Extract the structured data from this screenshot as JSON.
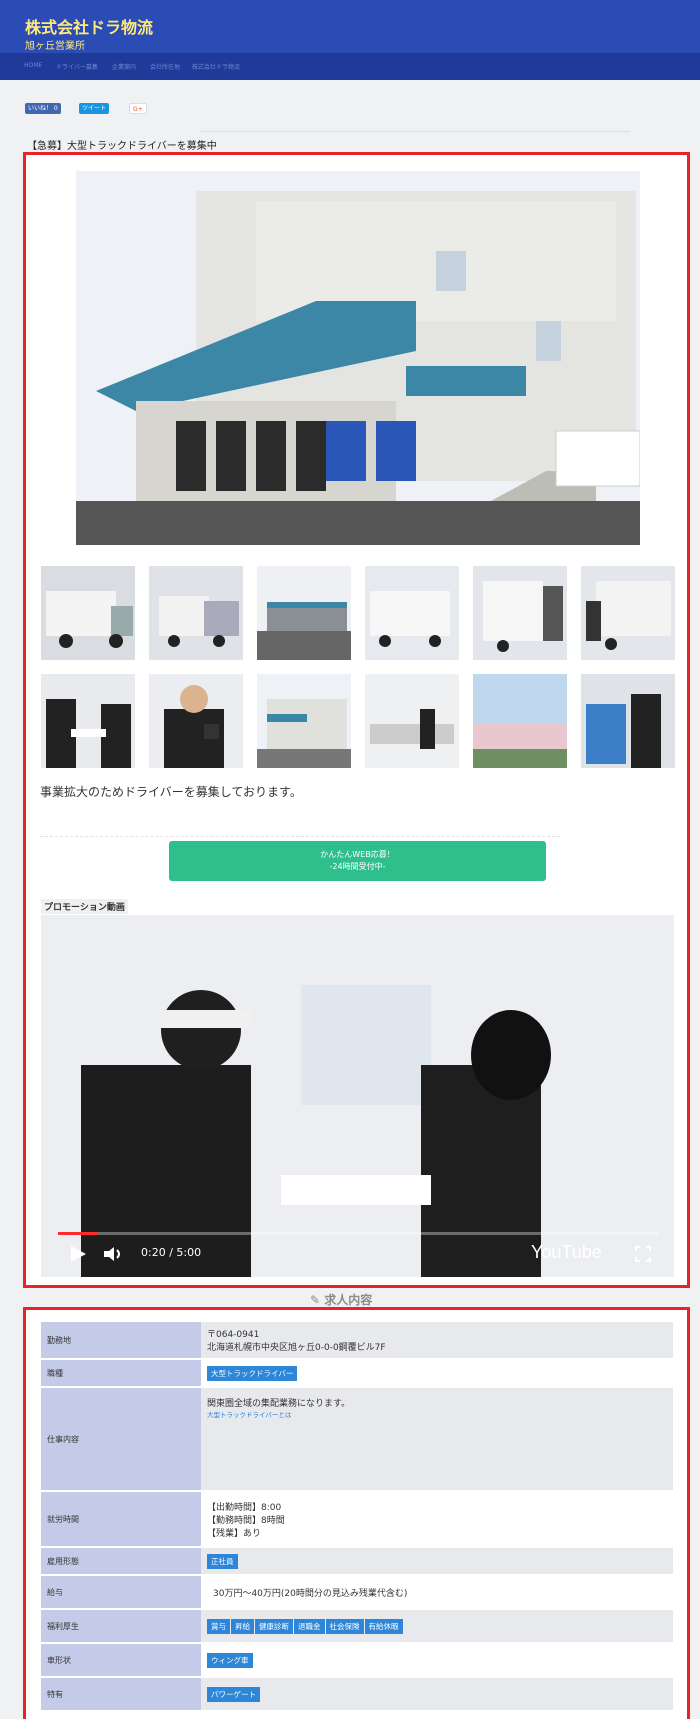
{
  "header": {
    "company": "株式会社ドラ物流",
    "branch": "旭ヶ丘営業所",
    "nav": [
      "HOME",
      "ドライバー募集",
      "企業案内",
      "会社所在地",
      "株式会社ドラ物流"
    ]
  },
  "social": {
    "like": "いいね！ 0",
    "tweet": "ツイート",
    "gplus": "G+"
  },
  "job": {
    "title": "【急募】大型トラックドライバーを募集中",
    "lead": "事業拡大のためドライバーを募集しております。",
    "apply_line1": "かんたんWEB応募！",
    "apply_line2": "-24時間受付中-",
    "promo_label": "プロモーション動画"
  },
  "video": {
    "time": "0:20 / 5:00",
    "brand": "YouTube",
    "progress": 0.067
  },
  "details": {
    "heading": "求人内容",
    "rows": {
      "location": {
        "label": "勤務地",
        "value1": "〒064-0941",
        "value2": "北海道札幌市中央区旭ヶ丘0-0-0鋼覆ビル7F"
      },
      "type": {
        "label": "職種",
        "tag": "大型トラックドライバー"
      },
      "work": {
        "label": "仕事内容",
        "value": "関東圏全域の集配業務になります。",
        "link": "大型トラックドライバーとは"
      },
      "hours": {
        "label": "就労時間",
        "line1": "【出勤時間】8:00",
        "line2": "【勤務時間】8時間",
        "line3": "【残業】あり"
      },
      "employment": {
        "label": "雇用形態",
        "tag": "正社員"
      },
      "salary": {
        "label": "給与",
        "value": "30万円～40万円(20時間分の見込み残業代含む)"
      },
      "welfare": {
        "label": "福利厚生",
        "tags": [
          "賞与",
          "昇給",
          "健康診断",
          "退職金",
          "社会保険",
          "有給休暇"
        ]
      },
      "vehicle": {
        "label": "車形状",
        "tag": "ウィング車"
      },
      "special": {
        "label": "特有",
        "tag": "パワーゲート"
      }
    }
  },
  "colors": {
    "header": "#2b4bb5",
    "accent_red": "#e8222a",
    "apply_green": "#2ebf8d",
    "tag_blue": "#2e86d8",
    "row_head": "#c3cbe8"
  }
}
